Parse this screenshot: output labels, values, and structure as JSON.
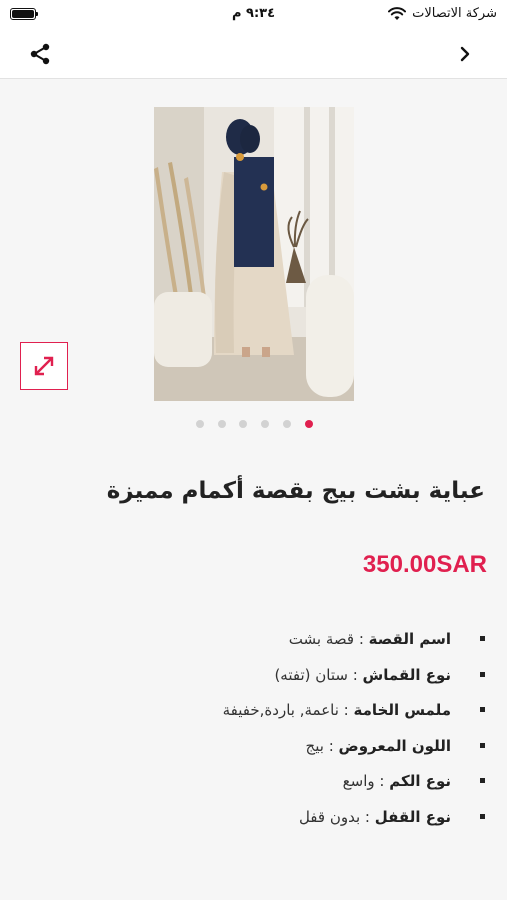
{
  "status_bar": {
    "carrier": "شركة الاتصالات",
    "time": "٩:٣٤ م"
  },
  "header": {
    "share_icon": "share-icon",
    "forward_icon": "chevron-right-icon"
  },
  "product": {
    "image_description": "product-photo",
    "expand_icon": "expand-arrows-icon",
    "dots_count": 6,
    "active_dot": 6,
    "title": "عباية بشت بيج بقصة أكمام مميزة",
    "price": "350.00SAR",
    "details": [
      {
        "label": "اسم القصة",
        "value": "قصة بشت"
      },
      {
        "label": "نوع القماش",
        "value": "ستان (تفته)"
      },
      {
        "label": "ملمس الخامة",
        "value": "ناعمة, باردة,خفيفة"
      },
      {
        "label": "اللون المعروض",
        "value": "بيج"
      },
      {
        "label": "نوع الكم",
        "value": "واسع"
      },
      {
        "label": "نوع القفل",
        "value": "بدون قفل"
      }
    ]
  },
  "colors": {
    "accent": "#e0204f",
    "dot_inactive": "#d2d2d2",
    "background": "#f6f6f6"
  }
}
